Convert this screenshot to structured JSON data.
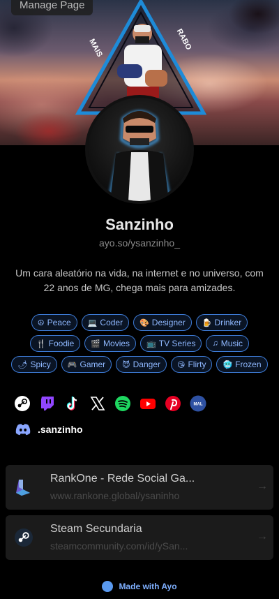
{
  "manage_button": "Manage Page",
  "banner_text": {
    "left": "MAIS",
    "right": "RABO"
  },
  "profile": {
    "name": "Sanzinho",
    "handle": "ayo.so/ysanzinho_",
    "bio": "Um cara aleatório na vida, na internet e no universo, com 22 anos de MG, chega mais para amizades."
  },
  "tags": [
    [
      {
        "emoji": "☮",
        "label": "Peace"
      },
      {
        "emoji": "💻",
        "label": "Coder"
      },
      {
        "emoji": "🎨",
        "label": "Designer"
      },
      {
        "emoji": "🍺",
        "label": "Drinker"
      }
    ],
    [
      {
        "emoji": "🍴",
        "label": "Foodie"
      },
      {
        "emoji": "🎬",
        "label": "Movies"
      },
      {
        "emoji": "📺",
        "label": "TV Series"
      },
      {
        "emoji": "♫",
        "label": "Music"
      }
    ],
    [
      {
        "emoji": "🌶",
        "label": "Spicy"
      },
      {
        "emoji": "🎮",
        "label": "Gamer"
      },
      {
        "emoji": "😈",
        "label": "Danger"
      },
      {
        "emoji": "😘",
        "label": "Flirty"
      },
      {
        "emoji": "🥶",
        "label": "Frozen"
      }
    ]
  ],
  "socials": [
    "steam-icon",
    "twitch-icon",
    "tiktok-icon",
    "x-icon",
    "spotify-icon",
    "youtube-icon",
    "pinterest-icon",
    "myanimelist-icon"
  ],
  "mal_label": "MAL",
  "discord": {
    "icon": "discord-icon",
    "username": ".sanzinho"
  },
  "links": [
    {
      "title": "RankOne - Rede Social Ga...",
      "url": "www.rankone.global/ysaninho",
      "icon": "rankone-icon"
    },
    {
      "title": "Steam Secundaria",
      "url": "steamcommunity.com/id/ySan...",
      "icon": "steam-icon"
    }
  ],
  "footer": "Made with Ayo",
  "colors": {
    "accent": "#3d7bd6",
    "tag_text": "#8fb8ff",
    "card_bg": "#1b1b1b"
  }
}
